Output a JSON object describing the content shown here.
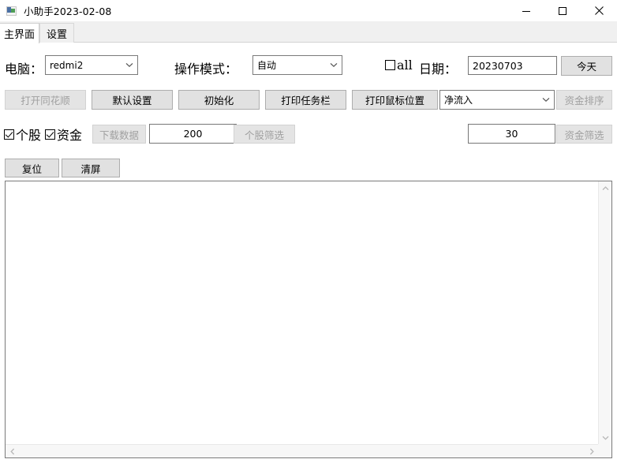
{
  "window": {
    "title": "小助手2023-02-08",
    "icon": "app-icon",
    "controls": {
      "minimize": "minimize-icon",
      "maximize": "maximize-icon",
      "close": "close-icon"
    }
  },
  "tabs": [
    {
      "label": "主界面",
      "active": true
    },
    {
      "label": "设置",
      "active": false
    }
  ],
  "row1": {
    "computer_label": "电脑：",
    "computer_value": "redmi2",
    "mode_label": "操作模式：",
    "mode_value": "自动",
    "all_checkbox_label": "all",
    "all_checked": false,
    "date_label": "日期：",
    "date_value": "20230703",
    "today_button": "今天"
  },
  "row2": {
    "open_ths": "打开同花顺",
    "open_ths_disabled": true,
    "default_settings": "默认设置",
    "initialize": "初始化",
    "print_taskbar": "打印任务栏",
    "print_mouse_pos": "打印鼠标位置",
    "flow_select_value": "净流入",
    "fund_sort": "资金排序",
    "fund_sort_disabled": true
  },
  "row3": {
    "stock_checkbox_label": "个股",
    "stock_checked": true,
    "fund_checkbox_label": "资金",
    "fund_checked": true,
    "download_data": "下载数据",
    "download_data_disabled": true,
    "count_value": "200",
    "stock_filter": "个股筛选",
    "stock_filter_disabled": true,
    "amount_value": "30",
    "fund_filter": "资金筛选",
    "fund_filter_disabled": true
  },
  "row4": {
    "reset": "复位",
    "clear_screen": "清屏"
  },
  "output": {
    "text": ""
  },
  "colors": {
    "window_bg": "#ffffff",
    "tabstrip_bg": "#f0f0f0",
    "button_face": "#e1e1e1",
    "button_border": "#adadad",
    "disabled_text": "#a0a0a0",
    "field_border": "#767676",
    "scrollbar_bg": "#f7f7f7",
    "scrollbar_arrow": "#b8b8b8"
  }
}
